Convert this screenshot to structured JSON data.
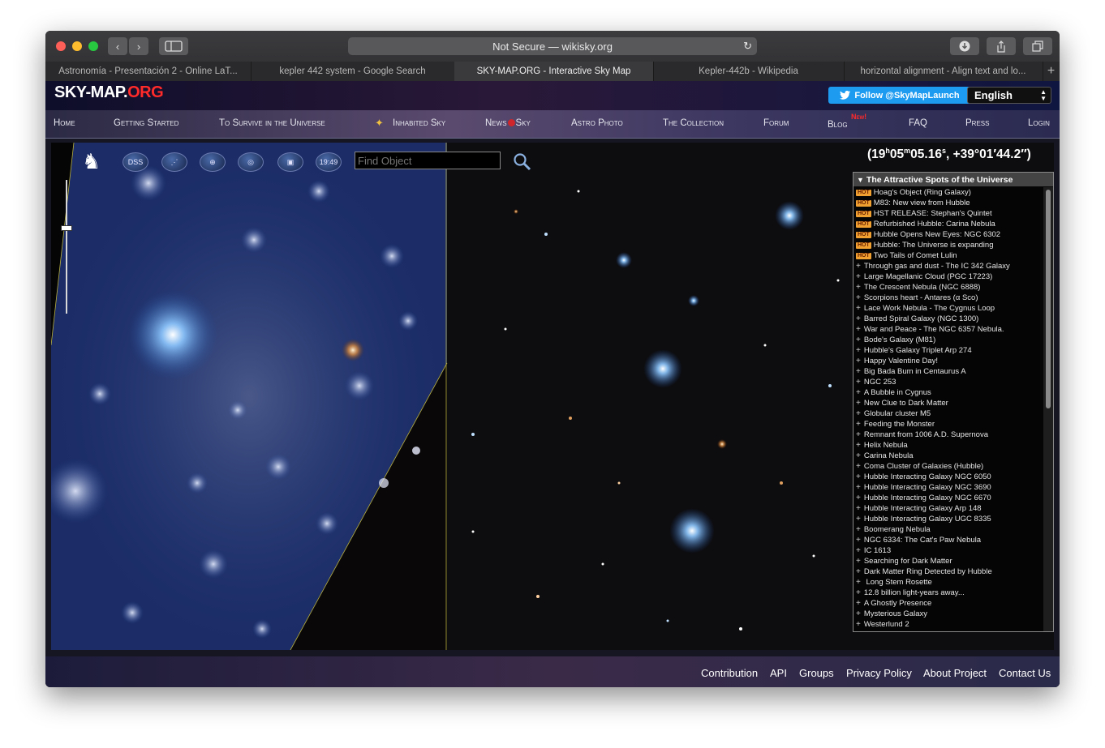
{
  "browser": {
    "address": "Not Secure — wikisky.org",
    "tabs": [
      "Astronomía - Presentación 2 - Online LaT...",
      "kepler 442 system - Google Search",
      "SKY-MAP.ORG - Interactive Sky Map",
      "Kepler-442b - Wikipedia",
      "horizontal alignment - Align text and lo..."
    ]
  },
  "header": {
    "logo_main": "SKY-MAP.",
    "logo_org": "ORG",
    "follow": "Follow @SkyMapLaunch",
    "language": "English"
  },
  "nav": {
    "items": [
      "Home",
      "Getting Started",
      "To Survive in the Universe",
      "Inhabited Sky",
      "News",
      "Sky",
      "Astro Photo",
      "The Collection",
      "Forum",
      "Blog",
      "New!",
      "FAQ",
      "Press",
      "Login"
    ]
  },
  "map": {
    "tools": {
      "dss": "DSS",
      "time": "19:49"
    },
    "find_placeholder": "Find Object",
    "coord_ra": "(19",
    "coord_h": "h",
    "coord_m1": "05",
    "coord_m": "m",
    "coord_s1": "05.16",
    "coord_s": "s",
    "coord_dec": ", +39°01′44.2″)"
  },
  "panel": {
    "title": "The Attractive Spots of the Universe",
    "hot_label": "HOT",
    "hot_items": [
      "Hoag's Object (Ring Galaxy)",
      "M83: New view from Hubble",
      "HST RELEASE: Stephan's Quintet",
      "Refurbished Hubble: Carina Nebula",
      "Hubble Opens New Eyes: NGC 6302",
      "Hubble: The Universe is expanding",
      "Two Tails of Comet Lulin"
    ],
    "items": [
      "Through gas and dust - The IC 342 Galaxy",
      "Large Magellanic Cloud (PGC 17223)",
      "The Crescent Nebula (NGC 6888)",
      "Scorpions heart - Antares (α Sco)",
      "Lace Work Nebula - The Cygnus Loop",
      "Barred Spiral Galaxy (NGC 1300)",
      "War and Peace - The NGC 6357 Nebula.",
      "Bode's Galaxy (M81)",
      "Hubble's Galaxy Triplet Arp 274",
      "Happy Valentine Day!",
      "Big Bada Bum in Centaurus A",
      "NGC 253",
      "A Bubble in Cygnus",
      "New Clue to Dark Matter",
      "Globular cluster M5",
      "Feeding the Monster",
      "Remnant from 1006 A.D. Supernova",
      "Helix Nebula",
      "Carina Nebula",
      "Coma Cluster of Galaxies (Hubble)",
      "Hubble Interacting Galaxy NGC 6050",
      "Hubble Interacting Galaxy NGC 3690",
      "Hubble Interacting Galaxy NGC 6670",
      "Hubble Interacting Galaxy Arp 148",
      "Hubble Interacting Galaxy UGC 8335",
      "Boomerang Nebula",
      "NGC 6334: The Cat's Paw Nebula",
      "IC 1613",
      "Searching for Dark Matter",
      "Dark Matter Ring Detected by Hubble",
      " Long Stem Rosette",
      "12.8 billion light-years away...",
      "A Ghostly Presence",
      "Mysterious Galaxy",
      "Westerlund 2"
    ]
  },
  "footer": {
    "links": [
      "Contribution",
      "API",
      "Groups",
      "Privacy Policy",
      "About Project",
      "Contact Us"
    ]
  },
  "colors": {
    "accent_red": "#ff3030",
    "twitter": "#1d9bf0",
    "hot": "#f0a030"
  }
}
